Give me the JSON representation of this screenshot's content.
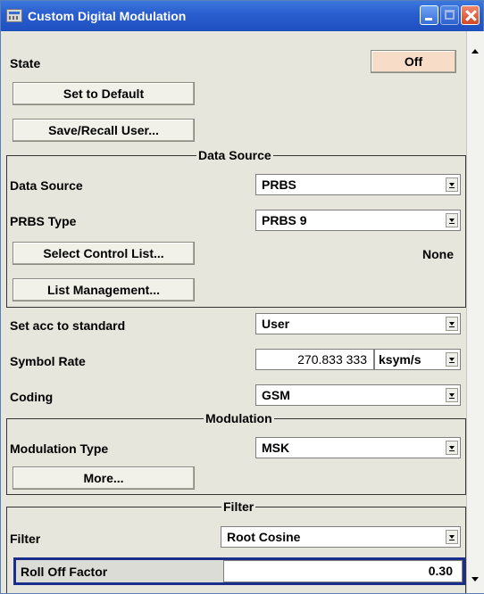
{
  "window": {
    "title": "Custom Digital Modulation"
  },
  "state": {
    "label": "State",
    "value": "Off"
  },
  "buttons": {
    "set_default": "Set to Default",
    "save_recall": "Save/Recall User...",
    "select_control_list": "Select Control List...",
    "list_management": "List Management...",
    "more": "More..."
  },
  "data_source_group": {
    "title": "Data Source",
    "data_source_label": "Data Source",
    "data_source_value": "PRBS",
    "prbs_type_label": "PRBS Type",
    "prbs_type_value": "PRBS 9",
    "control_list_value": "None"
  },
  "standard": {
    "label": "Set acc to standard",
    "value": "User"
  },
  "symbol_rate": {
    "label": "Symbol Rate",
    "value": "270.833 333",
    "unit": "ksym/s"
  },
  "coding": {
    "label": "Coding",
    "value": "GSM"
  },
  "modulation_group": {
    "title": "Modulation",
    "type_label": "Modulation Type",
    "type_value": "MSK"
  },
  "filter_group": {
    "title": "Filter",
    "filter_label": "Filter",
    "filter_value": "Root Cosine",
    "rolloff_label": "Roll Off Factor",
    "rolloff_value": "0.30"
  }
}
